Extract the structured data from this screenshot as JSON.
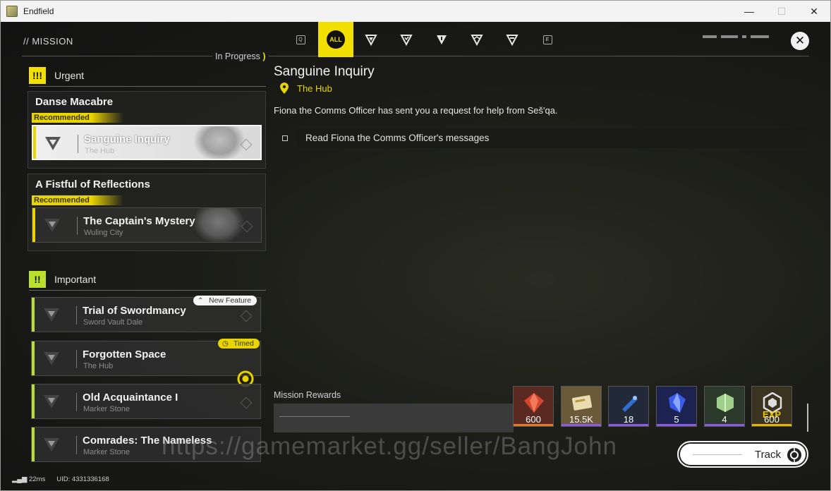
{
  "window": {
    "title": "Endfield",
    "minimize": "—",
    "maximize": "☐",
    "close": "✕"
  },
  "header": {
    "mission_label": "// MISSION",
    "in_progress": "In Progress",
    "bracket": ")",
    "tabs": [
      {
        "name": "tab-q",
        "label": "Q"
      },
      {
        "name": "tab-all",
        "label": "ALL"
      },
      {
        "name": "tab-type-1",
        "label": ""
      },
      {
        "name": "tab-type-2",
        "label": ""
      },
      {
        "name": "tab-type-3",
        "label": ""
      },
      {
        "name": "tab-type-4",
        "label": ""
      },
      {
        "name": "tab-type-5",
        "label": ""
      },
      {
        "name": "tab-e",
        "label": "E"
      }
    ],
    "close_glyph": "✕"
  },
  "urgent": {
    "label": "Urgent",
    "badge": "!!!",
    "groups": [
      {
        "title": "Danse Macabre",
        "tag": "Recommended",
        "mission": {
          "title": "Sanguine Inquiry",
          "location": "The Hub"
        }
      },
      {
        "title": "A Fistful of Reflections",
        "tag": "Recommended",
        "mission": {
          "title": "The Captain's Mystery",
          "location": "Wuling City"
        }
      }
    ]
  },
  "important": {
    "label": "Important",
    "badge": "!!",
    "missions": [
      {
        "title": "Trial of Swordmancy",
        "location": "Sword Vault Dale",
        "pill": "New Feature"
      },
      {
        "title": "Forgotten Space",
        "location": "The Hub",
        "pill": "Timed"
      },
      {
        "title": "Old Acquaintance I",
        "location": "Marker Stone"
      },
      {
        "title": "Comrades: The Nameless",
        "location": "Marker Stone"
      }
    ]
  },
  "detail": {
    "title": "Sanguine Inquiry",
    "location": "The Hub",
    "description": "Fiona the Comms Officer has sent you a request for help from Seš'qa.",
    "objective": "Read Fiona the Comms Officer's messages"
  },
  "rewards": {
    "label": "Mission Rewards",
    "items": [
      {
        "value": "600",
        "color": "#e07a2a",
        "bg": "#5a2a22",
        "icon": "red-crystal-icon"
      },
      {
        "value": "15.5K",
        "color": "#8a5ae0",
        "bg": "#6a5a3a",
        "icon": "ticket-icon"
      },
      {
        "value": "18",
        "color": "#8a5ae0",
        "bg": "#222a3a",
        "icon": "blue-tool-icon"
      },
      {
        "value": "5",
        "color": "#8a5ae0",
        "bg": "#1c2350",
        "icon": "blue-crystal-icon"
      },
      {
        "value": "4",
        "color": "#8a5ae0",
        "bg": "#2c3a2c",
        "icon": "green-crystal-icon"
      },
      {
        "value": "600",
        "color": "#e8b400",
        "bg": "#3a3320",
        "icon": "exp-icon",
        "overlay": "EXP"
      }
    ]
  },
  "watermark": "https://gamemarket.gg/seller/BangJohn",
  "track_label": "Track",
  "status": {
    "ping": "22ms",
    "uid": "UID: 4331336168"
  },
  "colors": {
    "accent": "#f2df00",
    "important": "#b9e02a"
  }
}
